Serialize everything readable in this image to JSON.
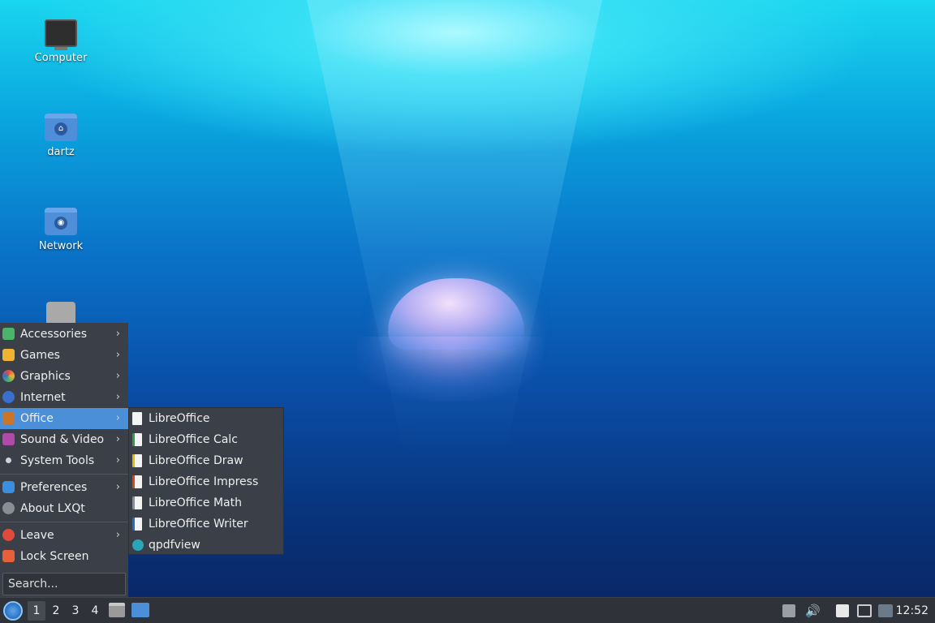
{
  "desktop": {
    "icons": [
      {
        "label": "Computer",
        "icon": "computer-icon"
      },
      {
        "label": "dartz",
        "icon": "home-folder-icon"
      },
      {
        "label": "Network",
        "icon": "network-folder-icon"
      },
      {
        "label": "",
        "icon": "trash-icon"
      }
    ]
  },
  "menu": {
    "items": [
      {
        "label": "Accessories",
        "icon": "accessories-icon",
        "color": "#4bb36a"
      },
      {
        "label": "Games",
        "icon": "games-icon",
        "color": "#f0b430"
      },
      {
        "label": "Graphics",
        "icon": "graphics-icon",
        "color": "#e0503a"
      },
      {
        "label": "Internet",
        "icon": "internet-icon",
        "color": "#3a6fd0"
      },
      {
        "label": "Office",
        "icon": "office-icon",
        "color": "#c9762b"
      },
      {
        "label": "Sound & Video",
        "icon": "sound-video-icon",
        "color": "#b04aa8"
      },
      {
        "label": "System Tools",
        "icon": "system-tools-icon",
        "color": "#cfd3d8"
      }
    ],
    "preferences": {
      "label": "Preferences",
      "icon": "preferences-icon",
      "color": "#3a8fe0"
    },
    "about": {
      "label": "About LXQt",
      "icon": "info-icon",
      "color": "#8a8e94"
    },
    "leave": {
      "label": "Leave",
      "icon": "power-icon",
      "color": "#e04a3a"
    },
    "lock": {
      "label": "Lock Screen",
      "icon": "lock-icon",
      "color": "#e8603a"
    },
    "search_placeholder": "Search..."
  },
  "office_submenu": {
    "items": [
      {
        "label": "LibreOffice",
        "icon": "libreoffice-icon"
      },
      {
        "label": "LibreOffice Calc",
        "icon": "libreoffice-calc-icon"
      },
      {
        "label": "LibreOffice Draw",
        "icon": "libreoffice-draw-icon"
      },
      {
        "label": "LibreOffice Impress",
        "icon": "libreoffice-impress-icon"
      },
      {
        "label": "LibreOffice Math",
        "icon": "libreoffice-math-icon"
      },
      {
        "label": "LibreOffice Writer",
        "icon": "libreoffice-writer-icon"
      },
      {
        "label": "qpdfview",
        "icon": "qpdfview-icon"
      }
    ]
  },
  "taskbar": {
    "workspaces": [
      "1",
      "2",
      "3",
      "4"
    ],
    "active_workspace": "1",
    "clock": "12:52"
  }
}
